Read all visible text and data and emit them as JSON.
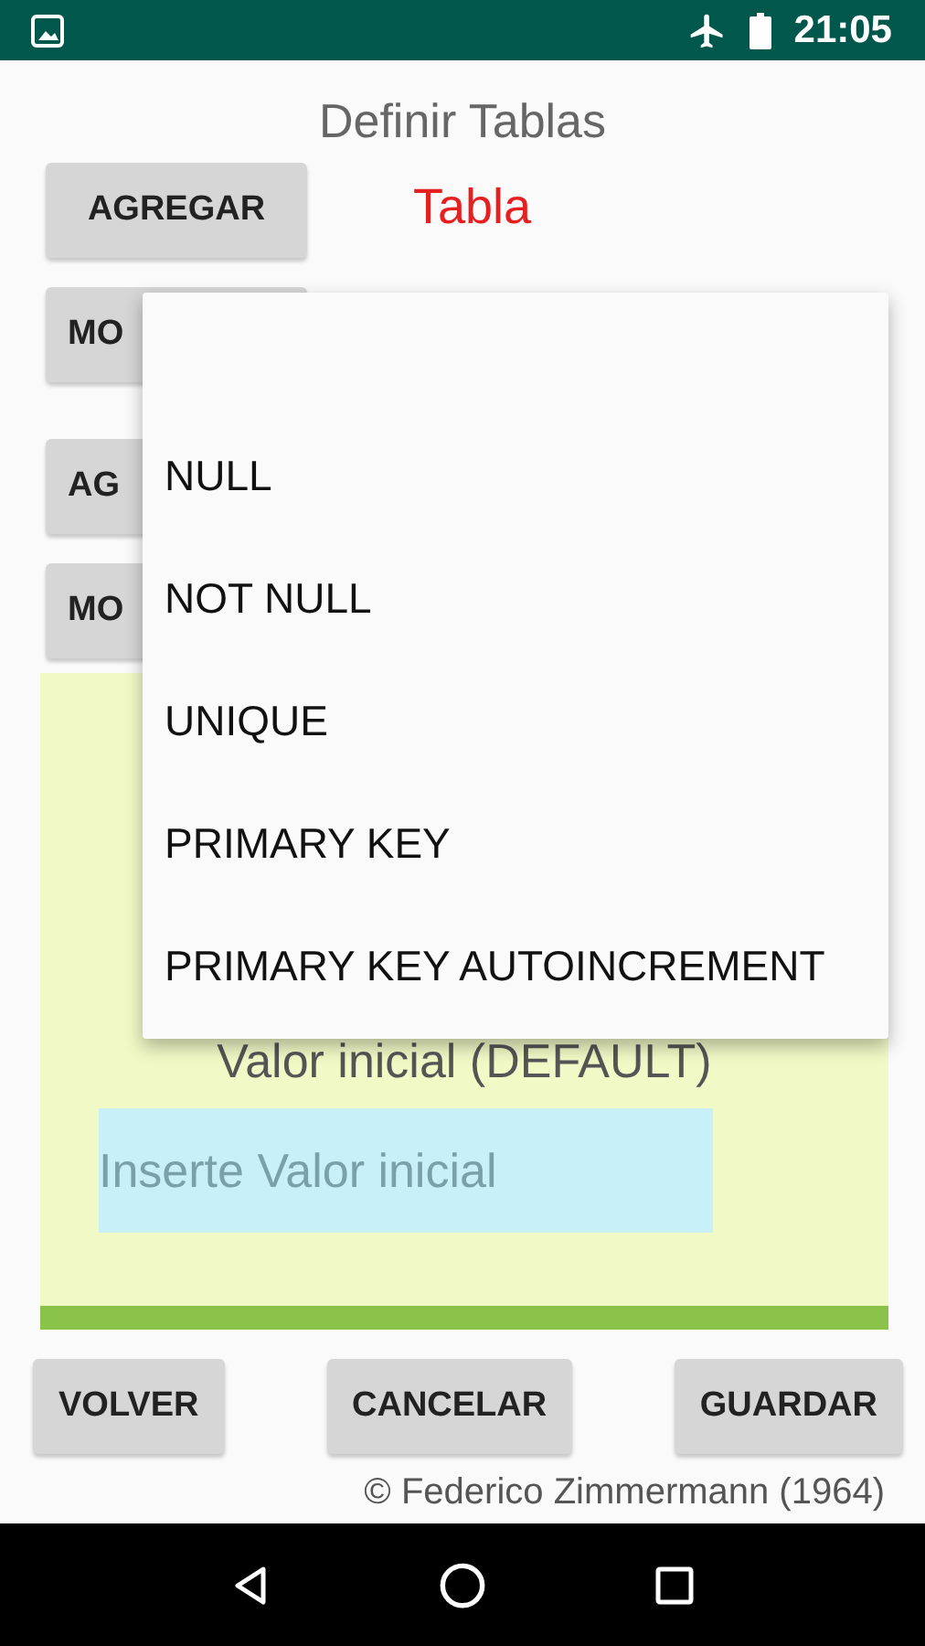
{
  "status_bar": {
    "time": "21:05"
  },
  "title": "Definir Tablas",
  "table_label": "Tabla",
  "side_buttons": [
    "AGREGAR",
    "MO",
    "AG",
    "MO"
  ],
  "panel": {
    "default_label": "Valor inicial (DEFAULT)",
    "default_field": {
      "placeholder": "Inserte Valor inicial"
    }
  },
  "bottom_buttons": [
    "VOLVER",
    "CANCELAR",
    "GUARDAR"
  ],
  "footer": "© Federico Zimmermann (1964)",
  "dropdown": {
    "options": [
      {
        "label": "NULL"
      },
      {
        "label": "NOT NULL"
      },
      {
        "label": "UNIQUE"
      },
      {
        "label": "PRIMARY KEY"
      },
      {
        "label": "PRIMARY KEY AUTOINCREMENT"
      }
    ]
  }
}
